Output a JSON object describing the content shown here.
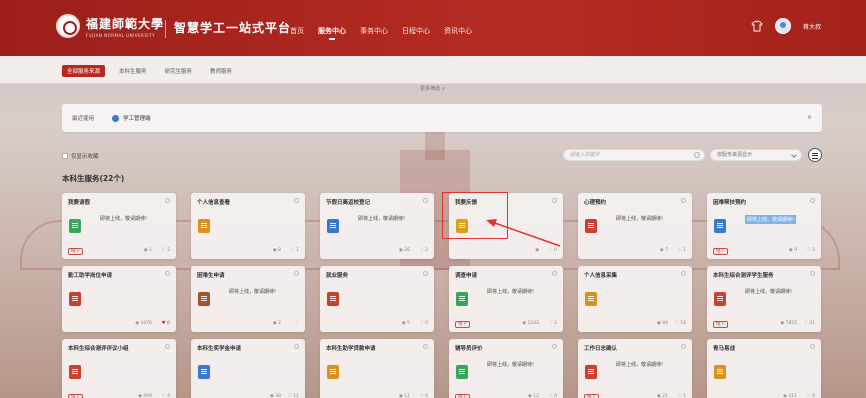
{
  "header": {
    "university_cn": "福建師範大學",
    "university_en": "FUJIAN NORMAL UNIVERSITY",
    "platform": "智慧学工一站式平台",
    "nav": [
      "首页",
      "服务中心",
      "事务中心",
      "日程中心",
      "资讯中心"
    ],
    "active_nav": "服务中心",
    "user_name": "蒋大叔"
  },
  "filter_bar": {
    "tabs": [
      "全部服务来源",
      "本科生服务",
      "研究生服务",
      "教师服务"
    ],
    "active_tab": "全部服务来源",
    "more_filter": "更多筛选 ∨"
  },
  "recent": {
    "label": "最近使用",
    "chip": "学工管理端",
    "close": "×"
  },
  "toolbar": {
    "only_fav": "仅显示收藏",
    "search_placeholder": "请输入关键字",
    "sort_value": "按服务来源显示"
  },
  "section_title": "本科生服务(22个)",
  "cards": [
    {
      "title": "我要请假",
      "soon": "即将上线，敬请期待!",
      "badge": "线下",
      "views": "1",
      "likes": "2",
      "icon_color": "#3aa55c"
    },
    {
      "title": "个人信息查看",
      "soon": "",
      "badge": "",
      "views": "8",
      "likes": "1",
      "icon_color": "#d6941e"
    },
    {
      "title": "节假日离返校登记",
      "soon": "即将上线，敬请期待!",
      "badge": "",
      "views": "26",
      "likes": "2",
      "icon_color": "#3a78c9"
    },
    {
      "title": "我要反馈",
      "soon": "",
      "badge": "",
      "views": "",
      "likes": "0",
      "icon_color": "#d6a21e"
    },
    {
      "title": "心理预约",
      "soon": "即将上线，敬请期待!",
      "badge": "",
      "views": "7",
      "likes": "1",
      "icon_color": "#c9412f"
    },
    {
      "title": "困难帮扶预约",
      "soon": "即将上线，敬请期待!",
      "badge": "线下",
      "views": "9",
      "likes": "3",
      "icon_color": "#3a78c9"
    },
    {
      "title": "勤工助学岗位申请",
      "soon": "",
      "badge": "",
      "views": "1076",
      "likes": "0",
      "icon_color": "#c9412f"
    },
    {
      "title": "困难生申请",
      "soon": "即将上线，敬请期待!",
      "badge": "",
      "views": "2",
      "likes": "",
      "icon_color": "#a5532e"
    },
    {
      "title": "就业服务",
      "soon": "",
      "badge": "",
      "views": "5",
      "likes": "0",
      "icon_color": "#c9412f"
    },
    {
      "title": "调查申请",
      "soon": "即将上线，敬请期待!",
      "badge": "线下",
      "views": "1242",
      "likes": "2",
      "icon_color": "#3aa55c"
    },
    {
      "title": "个人信息采集",
      "soon": "",
      "badge": "",
      "views": "99",
      "likes": "16",
      "icon_color": "#d6941e"
    },
    {
      "title": "本科生综合测评学生服务",
      "soon": "即将上线，敬请期待!",
      "badge": "线下",
      "views": "7855",
      "likes": "31",
      "icon_color": "#c9412f"
    },
    {
      "title": "本科生综合测评评议小组",
      "soon": "",
      "badge": "线下",
      "views": "999",
      "likes": "4",
      "icon_color": "#c9412f"
    },
    {
      "title": "本科生奖学金申请",
      "soon": "",
      "badge": "",
      "views": "38",
      "likes": "11",
      "icon_color": "#3a78c9"
    },
    {
      "title": "本科生助学贷款申请",
      "soon": "",
      "badge": "",
      "views": "11",
      "likes": "0",
      "icon_color": "#d6941e"
    },
    {
      "title": "辅导员评价",
      "soon": "即将上线，敬请期待!",
      "badge": "线下",
      "views": "12",
      "likes": "0",
      "icon_color": "#3aa55c"
    },
    {
      "title": "工作日志确认",
      "soon": "即将上线，敬请期待!",
      "badge": "线下",
      "views": "21",
      "likes": "1",
      "icon_color": "#c9412f"
    },
    {
      "title": "青马易战",
      "soon": "",
      "badge": "",
      "views": "411",
      "likes": "0",
      "icon_color": "#d6941e"
    }
  ]
}
